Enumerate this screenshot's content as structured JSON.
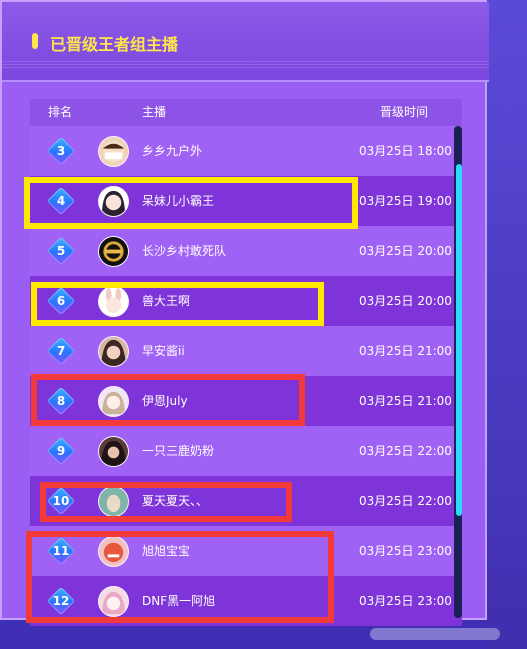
{
  "panel": {
    "title": "已晋级王者组主播",
    "accent_color": "#ffe54a"
  },
  "table": {
    "headers": {
      "rank": "排名",
      "host": "主播",
      "time": "晋级时间"
    },
    "rows": [
      {
        "rank": "3",
        "name": "乡乡九户外",
        "time": "03月25日 18:00",
        "avatar_icon": "mask-avatar-icon"
      },
      {
        "rank": "4",
        "name": "呆妹儿小霸王",
        "time": "03月25日 19:00",
        "avatar_icon": "girl-avatar-icon"
      },
      {
        "rank": "5",
        "name": "长沙乡村敢死队",
        "time": "03月25日 20:00",
        "avatar_icon": "emblem-avatar-icon"
      },
      {
        "rank": "6",
        "name": "兽大王啊",
        "time": "03月25日 20:00",
        "avatar_icon": "bunny-avatar-icon"
      },
      {
        "rank": "7",
        "name": "早安酱ii",
        "time": "03月25日 21:00",
        "avatar_icon": "photo-avatar-icon"
      },
      {
        "rank": "8",
        "name": "伊恩July",
        "time": "03月25日 21:00",
        "avatar_icon": "anime-avatar-icon"
      },
      {
        "rank": "9",
        "name": "一只三鹿奶粉",
        "time": "03月25日 22:00",
        "avatar_icon": "portrait-avatar-icon"
      },
      {
        "rank": "10",
        "name": "夏天夏天、、",
        "time": "03月25日 22:00",
        "avatar_icon": "pet-avatar-icon"
      },
      {
        "rank": "11",
        "name": "旭旭宝宝",
        "time": "03月25日 23:00",
        "avatar_icon": "cartoon-avatar-icon"
      },
      {
        "rank": "12",
        "name": "DNF黑一阿旭",
        "time": "03月25日 23:00",
        "avatar_icon": "doll-avatar-icon"
      }
    ]
  },
  "colors": {
    "background": "#3e2fb5",
    "panel": "#9a5ff2",
    "row_dark": "#7f34d9",
    "row_light": "#a062f5",
    "scroll_thumb": "#2fd6ff",
    "highlight_yellow": "#ffe800",
    "highlight_red": "#f23a3a"
  }
}
